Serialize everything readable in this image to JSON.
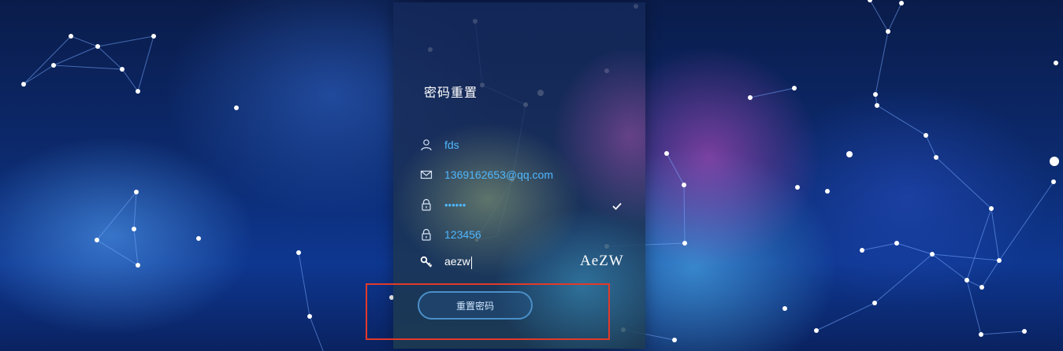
{
  "panel": {
    "title": "密码重置"
  },
  "form": {
    "username": "fds",
    "email": "1369162653@qq.com",
    "password_masked": "••••••",
    "confirm_password": "123456",
    "captcha_input": "aezw",
    "captcha_image_text": "AeZW",
    "submit_label": "重置密码"
  },
  "icons": {
    "username": "user-icon",
    "email": "envelope-icon",
    "password": "lock-icon",
    "confirm_password": "lock-icon",
    "captcha": "key-icon",
    "valid": "checkmark-icon"
  },
  "colors": {
    "input_text": "#4fb7ff",
    "button_border": "#4a8fc8",
    "highlight": "#e23a2a"
  }
}
